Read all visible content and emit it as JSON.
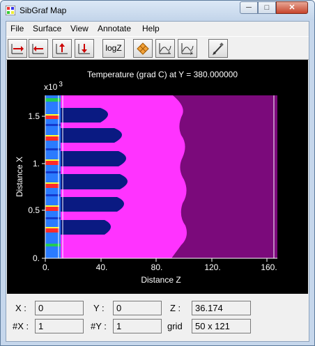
{
  "window": {
    "title": "SibGraf Map"
  },
  "menu": [
    "File",
    "Surface",
    "View",
    "Annotate",
    "Help"
  ],
  "toolbar": {
    "logz_label": "logZ"
  },
  "plot": {
    "title": "Temperature (grad C) at Y = 380.000000",
    "x_axis_label": "Distance Z",
    "y_axis_label": "Distance X",
    "y_multiplier": "x10",
    "y_multiplier_exp": "3",
    "x_ticks": [
      "0.",
      "40.",
      "80.",
      "120.",
      "160."
    ],
    "y_ticks": [
      "0.",
      "0.5",
      "1.",
      "1.5"
    ],
    "colors": {
      "background": "#000000",
      "plot_fill": "#7b0a7b",
      "magenta": "#ff33ff",
      "navy": "#0a1a82",
      "blue": "#2a7bff",
      "red": "#ff2a2a",
      "yellow": "#ffff33",
      "green": "#22cc55"
    }
  },
  "chart_data": {
    "type": "heatmap",
    "title": "Temperature (grad C) at Y = 380.000000",
    "xlabel": "Distance Z",
    "ylabel": "Distance X",
    "xlim": [
      0,
      160
    ],
    "ylim": [
      0,
      1.65
    ],
    "y_scale_note": "x10 3",
    "x_ticks": [
      0,
      40,
      80,
      120,
      160
    ],
    "y_ticks": [
      0,
      0.5,
      1,
      1.5
    ]
  },
  "status": {
    "x_label": "X :",
    "x_value": "0",
    "y_label": "Y :",
    "y_value": "0",
    "z_label": "Z :",
    "z_value": "36.174",
    "nx_label": "#X :",
    "nx_value": "1",
    "ny_label": "#Y :",
    "ny_value": "1",
    "grid_label": "grid",
    "grid_value": "50 x 121"
  }
}
